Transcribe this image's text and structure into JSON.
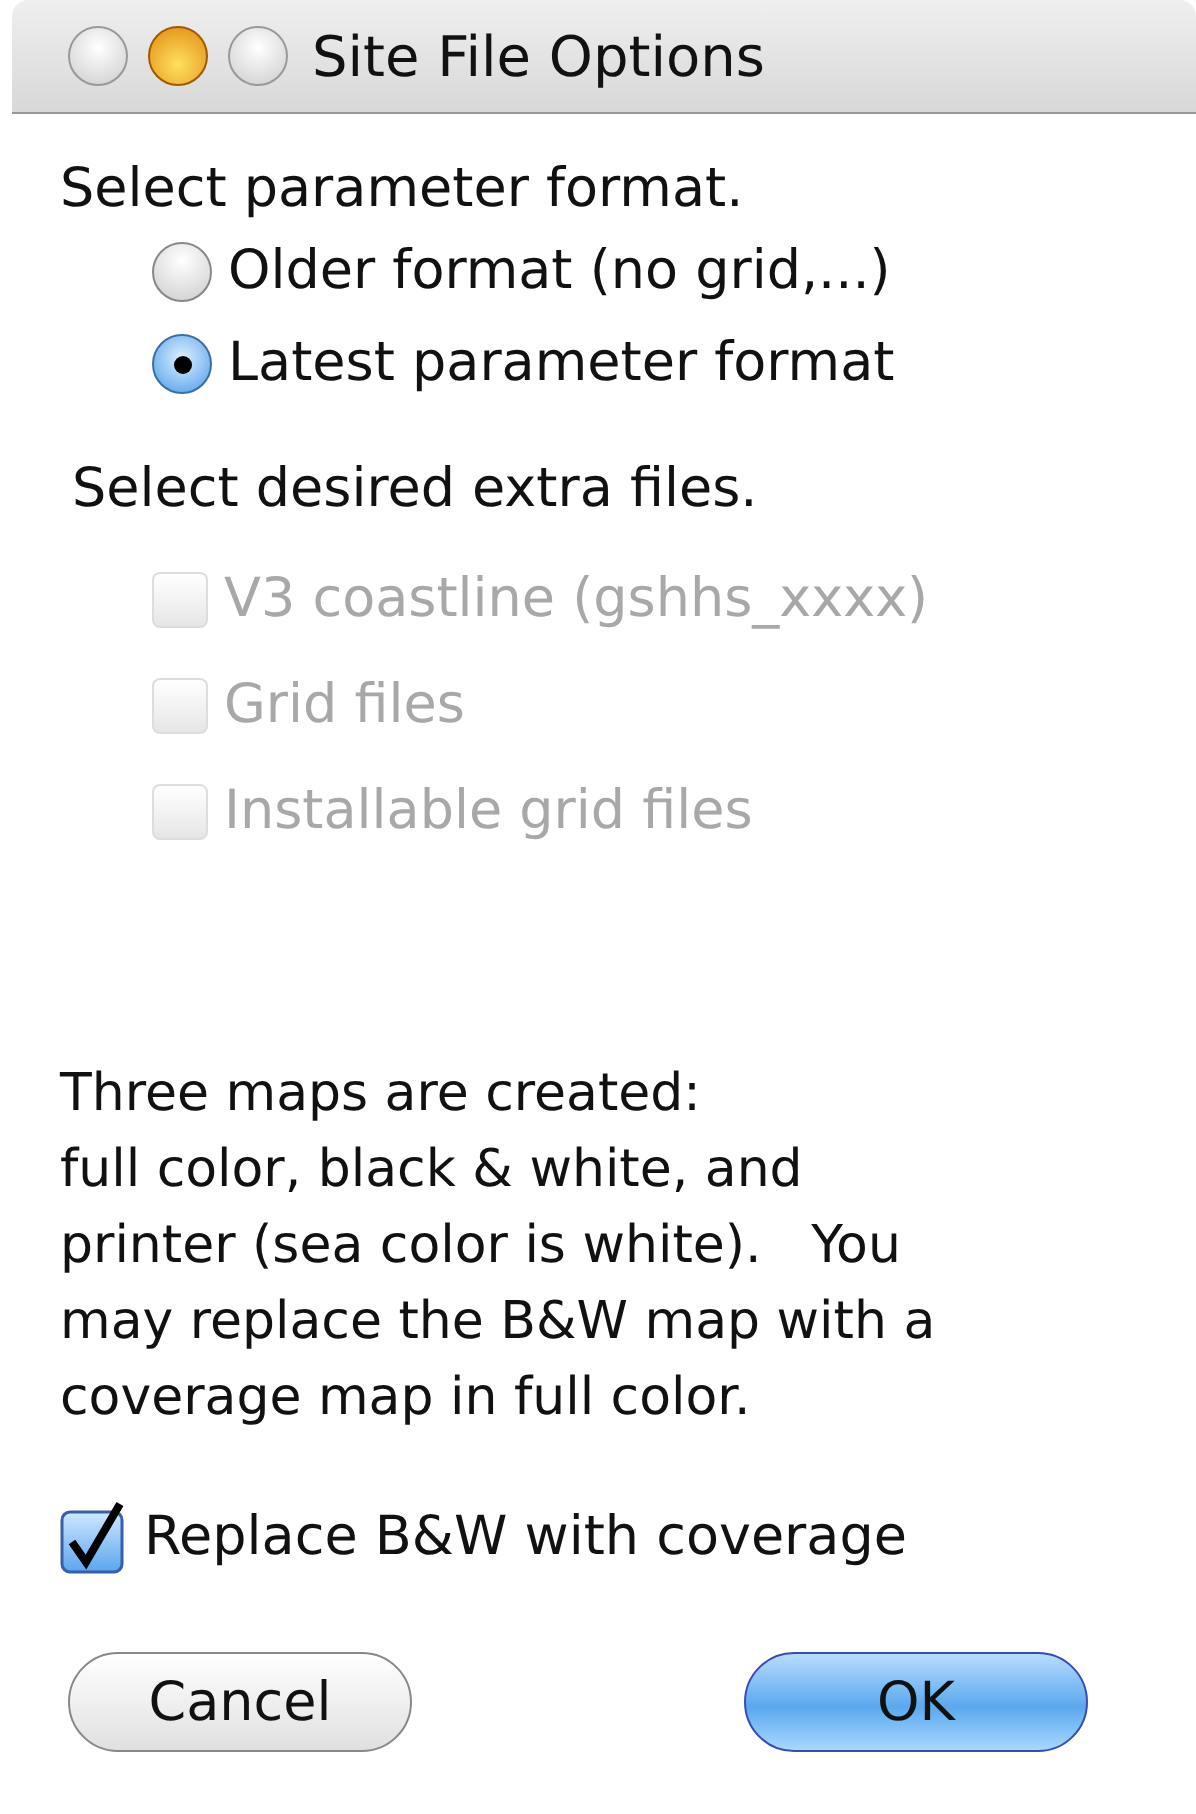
{
  "window": {
    "title": "Site File Options"
  },
  "format_prompt": "Select parameter format.",
  "formats": [
    {
      "label": "Older format (no grid,...)",
      "selected": false
    },
    {
      "label": "Latest parameter format",
      "selected": true
    }
  ],
  "extras_prompt": "Select desired extra files.",
  "extras": [
    {
      "label": "V3 coastline (gshhs_xxxx)",
      "checked": false,
      "disabled": true
    },
    {
      "label": "Grid files",
      "checked": false,
      "disabled": true
    },
    {
      "label": "Installable grid files",
      "checked": false,
      "disabled": true
    }
  ],
  "info": "Three maps are created:\nfull color, black & white, and\nprinter (sea color is white).   You\nmay replace the B&W map with a\ncoverage map in full color.",
  "replace_option": {
    "label": "Replace B&W with coverage",
    "checked": true
  },
  "buttons": [
    {
      "label": "Cancel",
      "kind": "normal"
    },
    {
      "label": "OK",
      "kind": "default"
    }
  ]
}
